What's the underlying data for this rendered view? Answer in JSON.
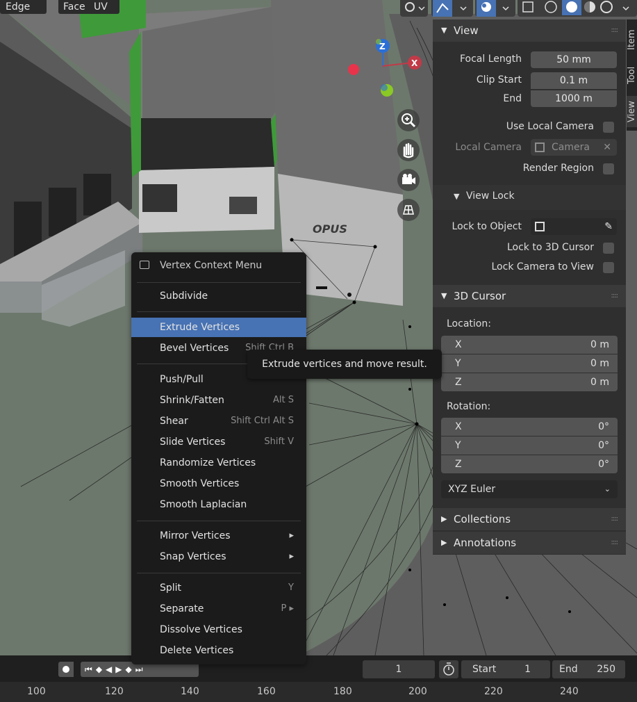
{
  "header": {
    "select_modes": [
      {
        "label": "Edge"
      },
      {
        "label": "Face"
      },
      {
        "label": "UV"
      }
    ]
  },
  "scene": {
    "sign_text": "OPUS"
  },
  "gizmo": {
    "z_label": "Z",
    "x_label": "X"
  },
  "tabs": [
    "Item",
    "Tool",
    "View"
  ],
  "sidebar": {
    "view_panel": {
      "title": "View",
      "focal_length_label": "Focal Length",
      "focal_length_value": "50 mm",
      "clip_start_label": "Clip Start",
      "clip_start_value": "0.1 m",
      "end_label": "End",
      "end_value": "1000 m",
      "use_local_camera": "Use Local Camera",
      "local_camera_label": "Local Camera",
      "local_camera_value": "Camera",
      "render_region": "Render Region"
    },
    "view_lock": {
      "title": "View Lock",
      "lock_to_object": "Lock to Object",
      "lock_to_3d_cursor": "Lock to 3D Cursor",
      "lock_camera_to_view": "Lock Camera to View"
    },
    "cursor_panel": {
      "title": "3D Cursor",
      "location_label": "Location:",
      "location": [
        {
          "axis": "X",
          "value": "0 m"
        },
        {
          "axis": "Y",
          "value": "0 m"
        },
        {
          "axis": "Z",
          "value": "0 m"
        }
      ],
      "rotation_label": "Rotation:",
      "rotation": [
        {
          "axis": "X",
          "value": "0°"
        },
        {
          "axis": "Y",
          "value": "0°"
        },
        {
          "axis": "Z",
          "value": "0°"
        }
      ],
      "rotation_mode": "XYZ Euler"
    },
    "collections": "Collections",
    "annotations": "Annotations"
  },
  "menu": {
    "title": "Vertex Context Menu",
    "items": [
      {
        "label": "Subdivide",
        "shortcut": ""
      },
      {
        "label": "Extrude Vertices",
        "shortcut": ""
      },
      {
        "label": "Bevel Vertices",
        "shortcut": "Shift Ctrl B"
      },
      {
        "label": "Push/Pull",
        "shortcut": ""
      },
      {
        "label": "Shrink/Fatten",
        "shortcut": "Alt S"
      },
      {
        "label": "Shear",
        "shortcut": "Shift Ctrl Alt S"
      },
      {
        "label": "Slide Vertices",
        "shortcut": "Shift V"
      },
      {
        "label": "Randomize Vertices",
        "shortcut": ""
      },
      {
        "label": "Smooth Vertices",
        "shortcut": ""
      },
      {
        "label": "Smooth Laplacian",
        "shortcut": ""
      },
      {
        "label": "Mirror Vertices",
        "shortcut": "▸"
      },
      {
        "label": "Snap Vertices",
        "shortcut": "▸"
      },
      {
        "label": "Split",
        "shortcut": "Y"
      },
      {
        "label": "Separate",
        "shortcut": "P ▸"
      },
      {
        "label": "Dissolve Vertices",
        "shortcut": ""
      },
      {
        "label": "Delete Vertices",
        "shortcut": ""
      }
    ]
  },
  "tooltip": "Extrude vertices and move result.",
  "timeline": {
    "current_frame": "1",
    "start_label": "Start",
    "start_value": "1",
    "end_label": "End",
    "end_value": "250",
    "ruler": [
      "100",
      "120",
      "140",
      "160",
      "180",
      "200",
      "220",
      "240"
    ]
  },
  "colors": {
    "highlight": "#4772b3",
    "sidebar_bg": "#2f2f2f",
    "menu_bg": "#1b1b1b",
    "gizmo_z": "#2b6fd6",
    "gizmo_x": "#c23a48",
    "gizmo_y": "#8ac926",
    "selection_green": "#3f9a3a"
  }
}
